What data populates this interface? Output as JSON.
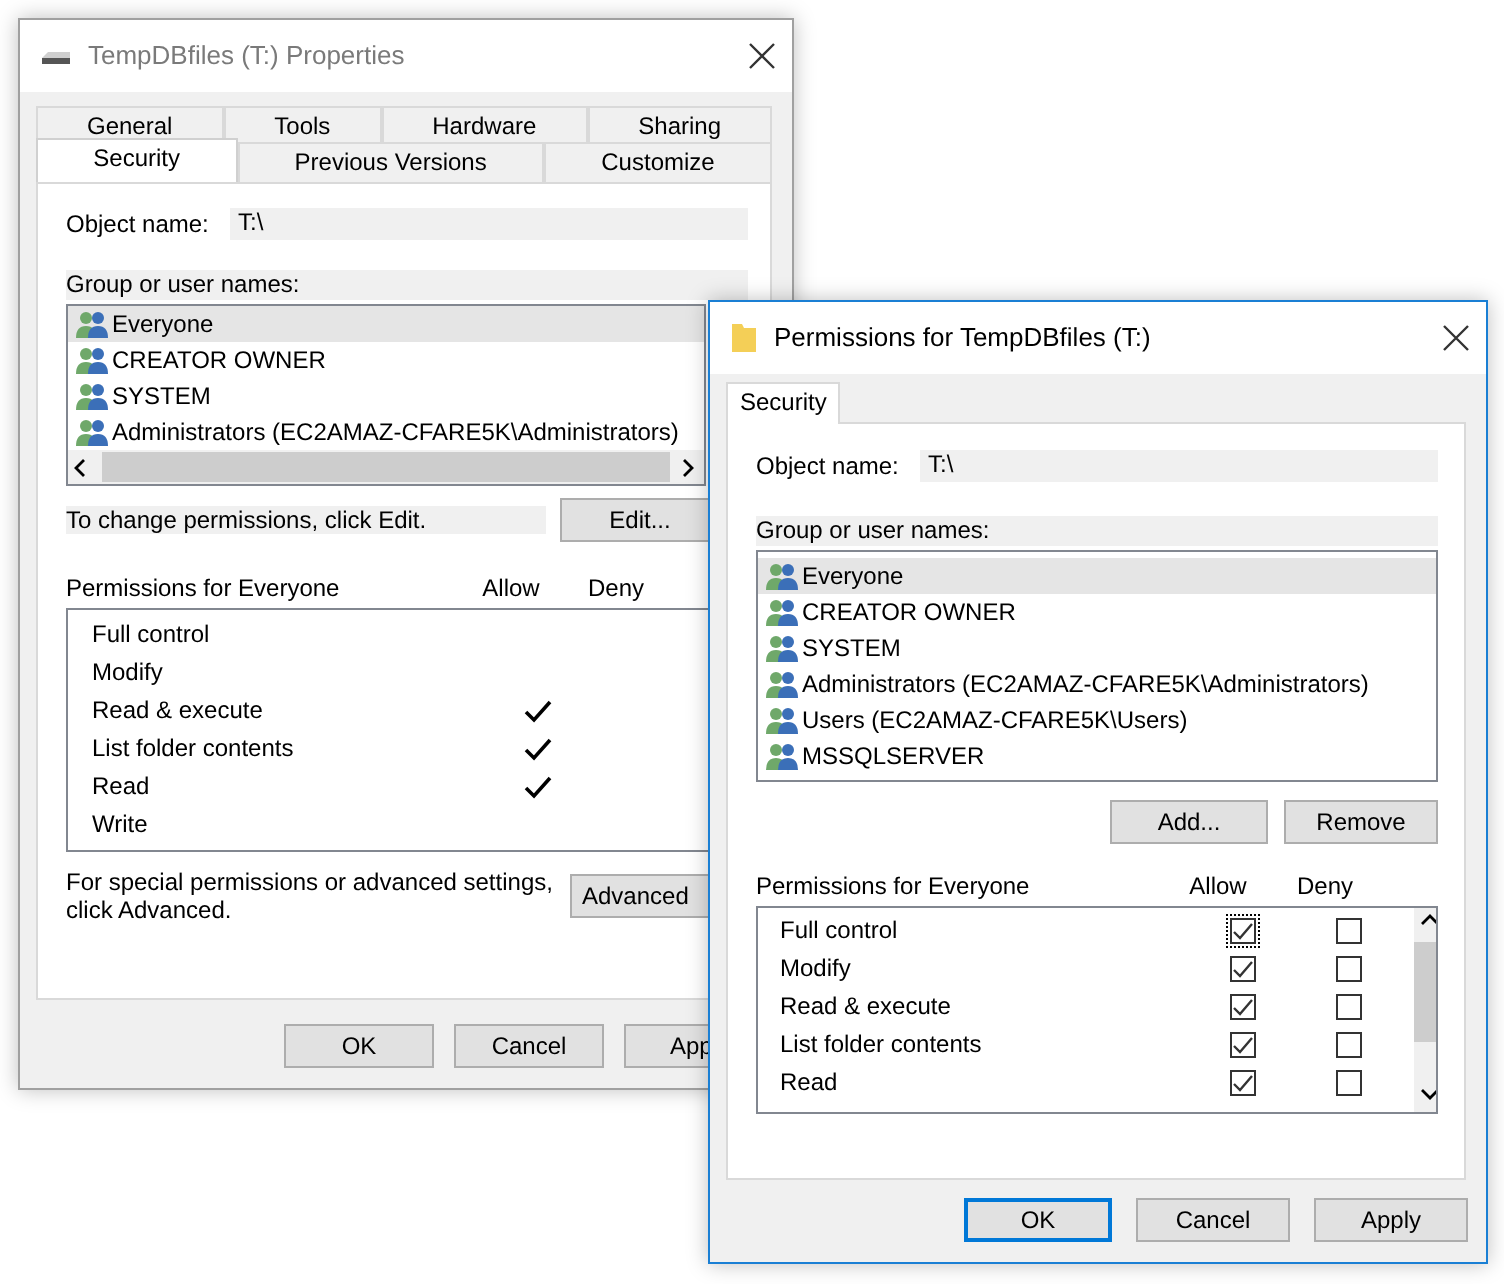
{
  "properties_window": {
    "title": "TempDBfiles (T:) Properties",
    "active": false,
    "tab_rows": [
      [
        {
          "label": "General",
          "selected": false
        },
        {
          "label": "Tools",
          "selected": false
        },
        {
          "label": "Hardware",
          "selected": false
        },
        {
          "label": "Sharing",
          "selected": false
        }
      ],
      [
        {
          "label": "Security",
          "selected": true
        },
        {
          "label": "Previous Versions",
          "selected": false
        },
        {
          "label": "Customize",
          "selected": false
        }
      ]
    ],
    "object_name_label": "Object name:",
    "object_name": "T:\\",
    "group_label": "Group or user names:",
    "users": [
      {
        "name": "Everyone",
        "selected": true
      },
      {
        "name": "CREATOR OWNER",
        "selected": false
      },
      {
        "name": "SYSTEM",
        "selected": false
      },
      {
        "name": "Administrators (EC2AMAZ-CFARE5K\\Administrators)",
        "selected": false
      }
    ],
    "edit_hint": "To change permissions, click Edit.",
    "edit_button": "Edit...",
    "permissions_label": "Permissions for Everyone",
    "allow_header": "Allow",
    "deny_header": "Deny",
    "permissions": [
      {
        "name": "Full control",
        "allow": false
      },
      {
        "name": "Modify",
        "allow": false
      },
      {
        "name": "Read & execute",
        "allow": true
      },
      {
        "name": "List folder contents",
        "allow": true
      },
      {
        "name": "Read",
        "allow": true
      },
      {
        "name": "Write",
        "allow": false
      }
    ],
    "advanced_hint": "For special permissions or advanced settings,\nclick Advanced.",
    "advanced_button": "Advanced",
    "buttons": [
      {
        "label": "OK",
        "default": false
      },
      {
        "label": "Cancel",
        "default": false
      },
      {
        "label": "App",
        "default": false
      }
    ]
  },
  "permissions_window": {
    "title": "Permissions for TempDBfiles (T:)",
    "active": true,
    "tabs": [
      {
        "label": "Security",
        "selected": true
      }
    ],
    "object_name_label": "Object name:",
    "object_name": "T:\\",
    "group_label": "Group or user names:",
    "users": [
      {
        "name": "Everyone",
        "selected": true
      },
      {
        "name": "CREATOR OWNER",
        "selected": false
      },
      {
        "name": "SYSTEM",
        "selected": false
      },
      {
        "name": "Administrators (EC2AMAZ-CFARE5K\\Administrators)",
        "selected": false
      },
      {
        "name": "Users (EC2AMAZ-CFARE5K\\Users)",
        "selected": false
      },
      {
        "name": "MSSQLSERVER",
        "selected": false
      }
    ],
    "add_button": "Add...",
    "remove_button": "Remove",
    "permissions_label": "Permissions for Everyone",
    "allow_header": "Allow",
    "deny_header": "Deny",
    "permissions": [
      {
        "name": "Full control",
        "allow": true,
        "deny": false,
        "focused": true
      },
      {
        "name": "Modify",
        "allow": true,
        "deny": false,
        "focused": false
      },
      {
        "name": "Read & execute",
        "allow": true,
        "deny": false,
        "focused": false
      },
      {
        "name": "List folder contents",
        "allow": true,
        "deny": false,
        "focused": false
      },
      {
        "name": "Read",
        "allow": true,
        "deny": false,
        "focused": false
      }
    ],
    "buttons": [
      {
        "label": "OK",
        "default": true
      },
      {
        "label": "Cancel",
        "default": false
      },
      {
        "label": "Apply",
        "default": false
      }
    ]
  }
}
